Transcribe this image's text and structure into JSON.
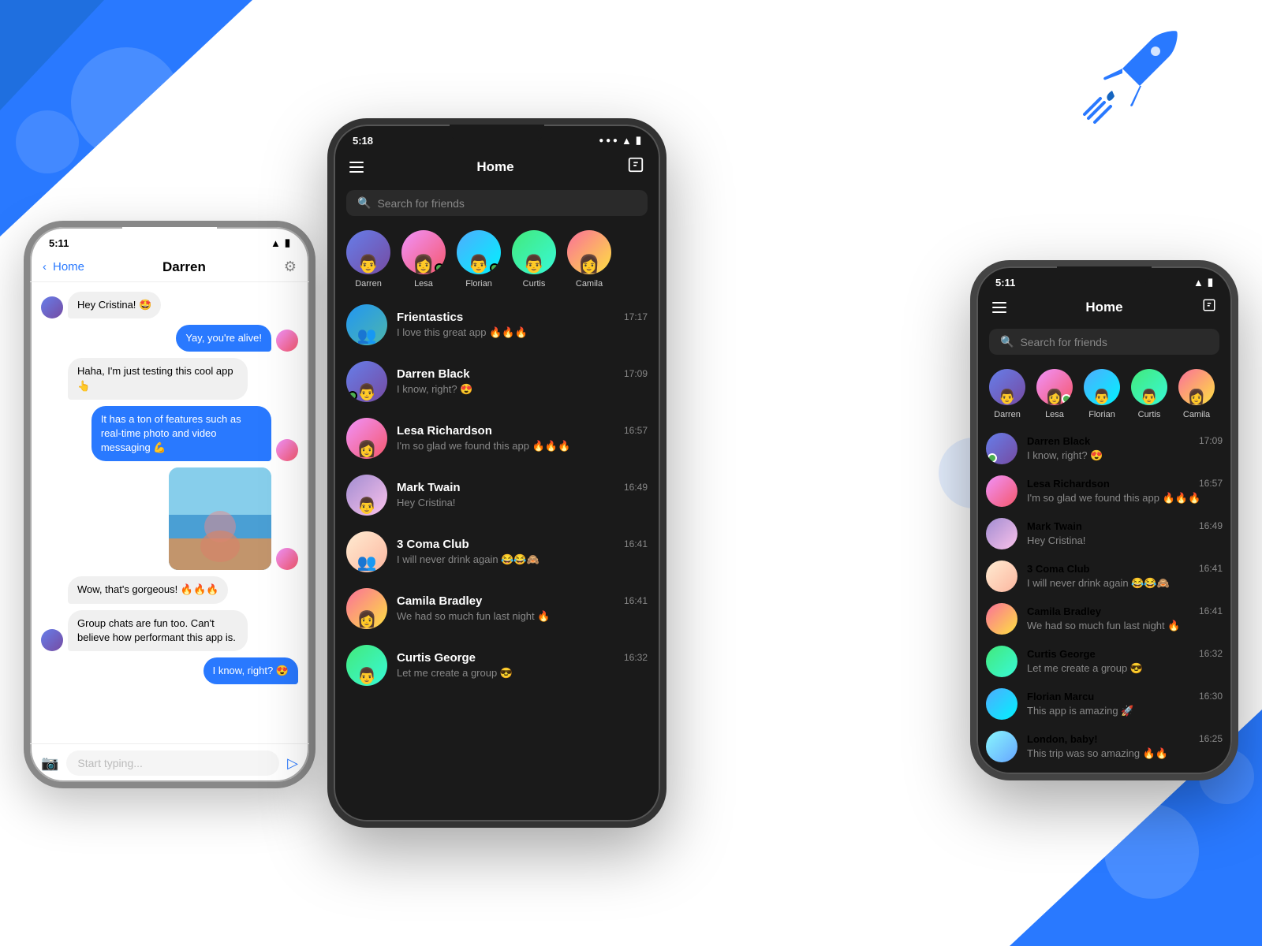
{
  "background": {
    "accent_color": "#2979ff"
  },
  "left_phone": {
    "status_bar": {
      "time": "5:11",
      "wifi": "wifi",
      "battery": "battery"
    },
    "header": {
      "back_label": "Home",
      "title": "Darren"
    },
    "messages": [
      {
        "id": 1,
        "side": "received",
        "text": "Hey Cristina! 🤩",
        "hasAvatar": true
      },
      {
        "id": 2,
        "side": "sent",
        "text": "Yay, you're alive!",
        "hasAvatar": true
      },
      {
        "id": 3,
        "side": "received",
        "text": "Haha, I'm just testing this cool app 👆",
        "hasAvatar": false
      },
      {
        "id": 4,
        "side": "sent",
        "text": "It has a ton of features such as real-time photo and video messaging 💪",
        "hasAvatar": true
      },
      {
        "id": 5,
        "side": "received",
        "text": "IMAGE",
        "hasAvatar": false
      },
      {
        "id": 6,
        "side": "received",
        "text": "Wow, that's gorgeous! 🔥🔥🔥",
        "hasAvatar": false
      },
      {
        "id": 7,
        "side": "received",
        "text": "Group chats are fun too. Can't believe how performant this app is.",
        "hasAvatar": true
      },
      {
        "id": 8,
        "side": "sent",
        "text": "I know, right? 😍",
        "hasAvatar": false
      }
    ],
    "input_placeholder": "Start typing..."
  },
  "center_phone": {
    "status_bar": {
      "time": "5:18"
    },
    "header": {
      "title": "Home",
      "menu_icon": "≡",
      "compose_icon": "compose"
    },
    "search": {
      "placeholder": "Search for friends"
    },
    "stories": [
      {
        "name": "Darren",
        "avatar_class": "av-darren",
        "online": false
      },
      {
        "name": "Lesa",
        "avatar_class": "av-lesa",
        "online": true
      },
      {
        "name": "Florian",
        "avatar_class": "av-florian",
        "online": false
      },
      {
        "name": "Curtis",
        "avatar_class": "av-curtis",
        "online": false
      },
      {
        "name": "Camila",
        "avatar_class": "av-camila",
        "online": false
      }
    ],
    "chats": [
      {
        "name": "Frientastics",
        "message": "I love this great app 🔥🔥🔥",
        "time": "17:17",
        "avatar_class": "av-frientastics",
        "online": false
      },
      {
        "name": "Darren Black",
        "message": "I know, right? 😍",
        "time": "17:09",
        "avatar_class": "av-darren",
        "online": true
      },
      {
        "name": "Lesa Richardson",
        "message": "I'm so glad we found this app 🔥🔥🔥",
        "time": "16:57",
        "avatar_class": "av-lesa",
        "online": false
      },
      {
        "name": "Mark Twain",
        "message": "Hey Cristina!",
        "time": "16:49",
        "avatar_class": "av-mark",
        "online": false
      },
      {
        "name": "3 Coma Club",
        "message": "I will never drink again 😂😂🙈",
        "time": "16:41",
        "avatar_class": "av-3coma",
        "online": false
      },
      {
        "name": "Camila Bradley",
        "message": "We had so much fun last night 🔥",
        "time": "16:41",
        "avatar_class": "av-camila",
        "online": false
      },
      {
        "name": "Curtis George",
        "message": "Let me create a group 😎",
        "time": "16:32",
        "avatar_class": "av-curtis",
        "online": false
      }
    ]
  },
  "right_phone": {
    "status_bar": {
      "time": "5:11"
    },
    "header": {
      "title": "Home"
    },
    "search": {
      "placeholder": "Search for friends"
    },
    "stories": [
      {
        "name": "Darren",
        "avatar_class": "av-darren",
        "online": false
      },
      {
        "name": "Lesa",
        "avatar_class": "av-lesa",
        "online": true
      },
      {
        "name": "Florian",
        "avatar_class": "av-florian",
        "online": false
      },
      {
        "name": "Curtis",
        "avatar_class": "av-curtis",
        "online": false
      },
      {
        "name": "Camila",
        "avatar_class": "av-camila",
        "online": false
      }
    ],
    "chats": [
      {
        "name": "Darren Black",
        "message": "I know, right? 😍",
        "time": "17:09",
        "avatar_class": "av-darren",
        "online": true
      },
      {
        "name": "Lesa Richardson",
        "message": "I'm so glad we found this app 🔥🔥🔥",
        "time": "16:57",
        "avatar_class": "av-lesa",
        "online": false
      },
      {
        "name": "Mark Twain",
        "message": "Hey Cristina!",
        "time": "16:49",
        "avatar_class": "av-mark",
        "online": false
      },
      {
        "name": "3 Coma Club",
        "message": "I will never drink again 😂😂🙈",
        "time": "16:41",
        "avatar_class": "av-3coma",
        "online": false
      },
      {
        "name": "Camila Bradley",
        "message": "We had so much fun last night 🔥",
        "time": "16:41",
        "avatar_class": "av-camila",
        "online": false
      },
      {
        "name": "Curtis George",
        "message": "Let me create a group 😎",
        "time": "16:32",
        "avatar_class": "av-curtis",
        "online": false
      },
      {
        "name": "Florian Marcu",
        "message": "This app is amazing 🚀",
        "time": "16:30",
        "avatar_class": "av-florian",
        "online": false
      },
      {
        "name": "London, baby!",
        "message": "This trip was so amazing 🔥🔥",
        "time": "16:25",
        "avatar_class": "av-london",
        "online": false
      }
    ]
  }
}
